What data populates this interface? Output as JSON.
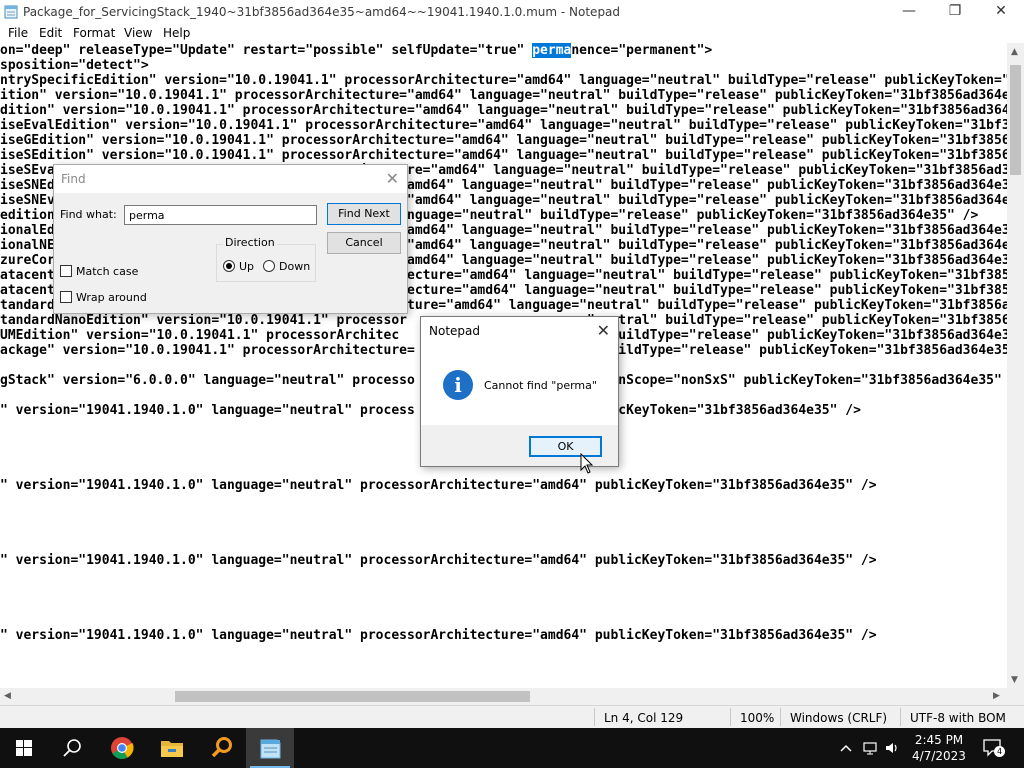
{
  "window": {
    "title": "Package_for_ServicingStack_1940~31bf3856ad364e35~amd64~~19041.1940.1.0.mum - Notepad",
    "minimize": "—",
    "maximize": "❐",
    "close": "✕"
  },
  "menu": [
    "File",
    "Edit",
    "Format",
    "View",
    "Help"
  ],
  "editor": {
    "selection_text": "perma",
    "lines": [
      {
        "pre": "on=\"deep\" releaseType=\"Update\" restart=\"possible\" selfUpdate=\"true\" ",
        "sel": "perma",
        "post": "nence=\"permanent\">"
      },
      {
        "pre": "sposition=\"detect\">"
      },
      {
        "pre": "ntrySpecificEdition\" version=\"10.0.19041.1\" processorArchitecture=\"amd64\" language=\"neutral\" buildType=\"release\" publicKeyToken=\"31bf3856ad364e35\" />"
      },
      {
        "pre": "ition\" version=\"10.0.19041.1\" processorArchitecture=\"amd64\" language=\"neutral\" buildType=\"release\" publicKeyToken=\"31bf3856ad364e35\" />"
      },
      {
        "pre": "dition\" version=\"10.0.19041.1\" processorArchitecture=\"amd64\" language=\"neutral\" buildType=\"release\" publicKeyToken=\"31bf3856ad364e35\" />"
      },
      {
        "pre": "iseEvalEdition\" version=\"10.0.19041.1\" processorArchitecture=\"amd64\" language=\"neutral\" buildType=\"release\" publicKeyToken=\"31bf3856ad364e35\" />"
      },
      {
        "pre": "iseGEdition\" version=\"10.0.19041.1\" processorArchitecture=\"amd64\" language=\"neutral\" buildType=\"release\" publicKeyToken=\"31bf3856ad364e35\" />"
      },
      {
        "pre": "iseSEdition\" version=\"10.0.19041.1\" processorArchitecture=\"amd64\" language=\"neutral\" buildType=\"release\" publicKeyToken=\"31bf3856ad364e35\" />"
      },
      {
        "pre": "iseSEval                                    chitecture=\"amd64\" language=\"neutral\" buildType=\"release\" publicKeyToken=\"31bf3856ad364e35\" />"
      },
      {
        "pre": "iseSNEd                                    tecture=\"amd64\" language=\"neutral\" buildType=\"release\" publicKeyToken=\"31bf3856ad364e35\" />"
      },
      {
        "pre": "iseSNEv                                    itecture=\"amd64\" language=\"neutral\" buildType=\"release\" publicKeyToken=\"31bf3856ad364e35\" />"
      },
      {
        "pre": "edition                                  =\"amd64\" language=\"neutral\" buildType=\"release\" publicKeyToken=\"31bf3856ad364e35\" />"
      },
      {
        "pre": "ionalEd                                    tecture=\"amd64\" language=\"neutral\" buildType=\"release\" publicKeyToken=\"31bf3856ad364e35\" />"
      },
      {
        "pre": "ionalNE                                    itecture=\"amd64\" language=\"neutral\" buildType=\"release\" publicKeyToken=\"31bf3856ad364e35\" />"
      },
      {
        "pre": "zureCor                                    tecture=\"amd64\" language=\"neutral\" buildType=\"release\" publicKeyToken=\"31bf3856ad364e35\" />"
      },
      {
        "pre": "atacent                                    sorArchitecture=\"amd64\" language=\"neutral\" buildType=\"release\" publicKeyToken=\"31bf3856ad364e35\" />"
      },
      {
        "pre": "atacent                                    sorArchitecture=\"amd64\" language=\"neutral\" buildType=\"release\" publicKeyToken=\"31bf3856ad364e35\" />"
      },
      {
        "pre": "tandard                                    rArchitecture=\"amd64\" language=\"neutral\" buildType=\"release\" publicKeyToken=\"31bf3856ad364e35\" />"
      },
      {
        "pre": "tandardNanoEdition\" version=\"10.0.19041.1\" processor                      =\"neutral\" buildType=\"release\" publicKeyToken=\"31bf3856ad364e35\" />"
      },
      {
        "pre": "UMEdition\" version=\"10.0.19041.1\" processorArchitec                      ral\" buildType=\"release\" publicKeyToken=\"31bf3856ad364e35\" />"
      },
      {
        "pre": "ackage\" version=\"10.0.19041.1\" processorArchitecture=                      \" buildType=\"release\" publicKeyToken=\"31bf3856ad364e35\" />"
      },
      {
        "pre": ""
      },
      {
        "pre": "gStack\" version=\"6.0.0.0\" language=\"neutral\" processo                      rsionScope=\"nonSxS\" publicKeyToken=\"31bf3856ad364e35\" />"
      },
      {
        "pre": ""
      },
      {
        "pre": "\" version=\"19041.1940.1.0\" language=\"neutral\" process                      ublicKeyToken=\"31bf3856ad364e35\" />"
      },
      {
        "pre": ""
      },
      {
        "pre": ""
      },
      {
        "pre": ""
      },
      {
        "pre": ""
      },
      {
        "pre": "\" version=\"19041.1940.1.0\" language=\"neutral\" processorArchitecture=\"amd64\" publicKeyToken=\"31bf3856ad364e35\" />"
      },
      {
        "pre": ""
      },
      {
        "pre": ""
      },
      {
        "pre": ""
      },
      {
        "pre": ""
      },
      {
        "pre": "\" version=\"19041.1940.1.0\" language=\"neutral\" processorArchitecture=\"amd64\" publicKeyToken=\"31bf3856ad364e35\" />"
      },
      {
        "pre": ""
      },
      {
        "pre": ""
      },
      {
        "pre": ""
      },
      {
        "pre": ""
      },
      {
        "pre": "\" version=\"19041.1940.1.0\" language=\"neutral\" processorArchitecture=\"amd64\" publicKeyToken=\"31bf3856ad364e35\" />"
      }
    ]
  },
  "find_dialog": {
    "title": "Find",
    "close": "✕",
    "find_what_label": "Find what:",
    "find_what_value": "perma",
    "find_next": "Find Next",
    "cancel": "Cancel",
    "direction_label": "Direction",
    "up": "Up",
    "down": "Down",
    "match_case": "Match case",
    "wrap_around": "Wrap around"
  },
  "message_box": {
    "title": "Notepad",
    "close": "✕",
    "icon": "info-icon",
    "message": "Cannot find \"perma\"",
    "ok": "OK"
  },
  "statusbar": {
    "position": "Ln 4, Col 129",
    "zoom": "100%",
    "line_ending": "Windows (CRLF)",
    "encoding": "UTF-8 with BOM"
  },
  "taskbar": {
    "time": "2:45 PM",
    "date": "4/7/2023",
    "notification_count": "4"
  },
  "colors": {
    "selection": "#0078d7",
    "taskbar": "#101010",
    "dialog_bg": "#f0f0f0",
    "info_icon": "#1e6fc6"
  }
}
